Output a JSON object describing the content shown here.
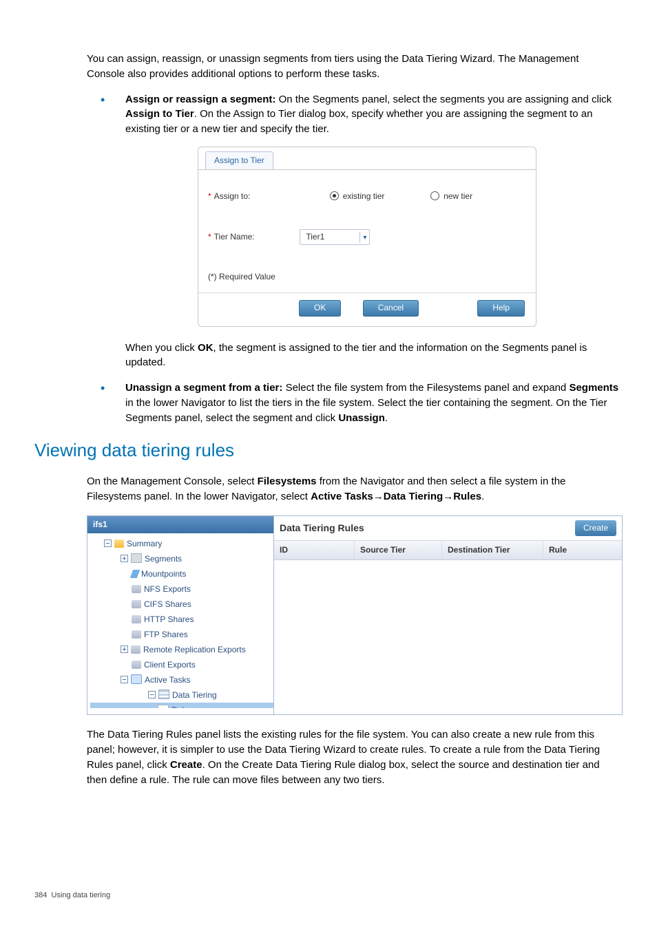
{
  "intro": "You can assign, reassign, or unassign segments from tiers using the Data Tiering Wizard. The Management Console also provides additional options to perform these tasks.",
  "bullet1": {
    "lead": "Assign or reassign a segment:",
    "text": " On the Segments panel, select the segments you are assigning and click ",
    "bold1": "Assign to Tier",
    "text2": ". On the Assign to Tier dialog box, specify whether you are assigning the segment to an existing tier or a new tier and specify the tier."
  },
  "dialog": {
    "tab": "Assign to Tier",
    "assignto_label": "Assign to:",
    "radio_existing": "existing tier",
    "radio_new": "new tier",
    "tiername_label": "Tier Name:",
    "tier_value": "Tier1",
    "required_note": "(*) Required Value",
    "buttons": {
      "ok": "OK",
      "cancel": "Cancel",
      "help": "Help"
    }
  },
  "after_dialog": {
    "pre": "When you click ",
    "ok": "OK",
    "post": ", the segment is assigned to the tier and the information on the Segments panel is updated."
  },
  "bullet2": {
    "lead": "Unassign a segment from a tier:",
    "text": " Select the file system from the Filesystems panel and expand ",
    "bold_seg": "Segments",
    "text2": " in the lower Navigator to list the tiers in the file system. Select the tier containing the segment. On the Tier Segments panel, select the segment and click ",
    "bold_un": "Unassign",
    "text3": "."
  },
  "heading": "Viewing data tiering rules",
  "para_nav": {
    "pre": "On the Management Console, select ",
    "b1": "Filesystems",
    "mid1": " from the Navigator and then select a file system in the Filesystems panel. In the lower Navigator, select ",
    "b2": "Active Tasks",
    "arrow1": "→",
    "b3": "Data Tiering",
    "arrow2": "→",
    "b4": "Rules",
    "end": "."
  },
  "navigator": {
    "title": "ifs1",
    "tree": [
      {
        "label": "Summary",
        "icon": "folder",
        "toggle": "−",
        "indent": 1
      },
      {
        "label": "Segments",
        "icon": "box",
        "toggle": "+",
        "indent": 2
      },
      {
        "label": "Mountpoints",
        "icon": "point",
        "indent": 3
      },
      {
        "label": "NFS Exports",
        "icon": "share",
        "indent": 3
      },
      {
        "label": "CIFS Shares",
        "icon": "share",
        "indent": 3
      },
      {
        "label": "HTTP Shares",
        "icon": "share",
        "indent": 3
      },
      {
        "label": "FTP Shares",
        "icon": "share",
        "indent": 3
      },
      {
        "label": "Remote Replication Exports",
        "icon": "share",
        "toggle": "+",
        "indent": 2
      },
      {
        "label": "Client Exports",
        "icon": "share",
        "indent": 3
      },
      {
        "label": "Active Tasks",
        "icon": "tasks",
        "toggle": "−",
        "indent": 2
      },
      {
        "label": "Data Tiering",
        "icon": "stack",
        "toggle": "−",
        "indent": 4
      },
      {
        "label": "Rules",
        "icon": "rule",
        "indent": 5,
        "selected": true
      }
    ]
  },
  "chart_data": {
    "type": "table",
    "title": "Data Tiering Rules",
    "columns": [
      "ID",
      "Source Tier",
      "Destination Tier",
      "Rule"
    ],
    "rows": []
  },
  "rulespanel": {
    "title": "Data Tiering Rules",
    "create": "Create",
    "cols": {
      "id": "ID",
      "src": "Source Tier",
      "dst": "Destination Tier",
      "rule": "Rule"
    }
  },
  "para_rules": {
    "text1": "The Data Tiering Rules panel lists the existing rules for the file system. You can also create a new rule from this panel; however, it is simpler to use the Data Tiering Wizard to create rules. To create a rule from the Data Tiering Rules panel, click ",
    "b_create": "Create",
    "text2": ". On the Create Data Tiering Rule dialog box, select the source and destination tier and then define a rule. The rule can move files between any two tiers."
  },
  "footer": {
    "page": "384",
    "section": "Using data tiering"
  }
}
